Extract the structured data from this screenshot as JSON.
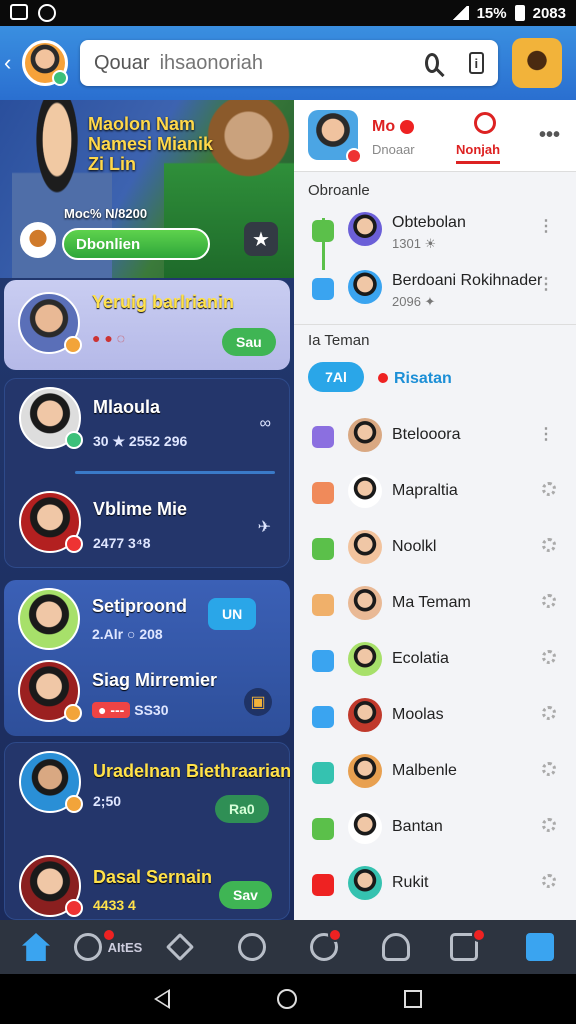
{
  "status_bar": {
    "battery": "15%",
    "time": "2083"
  },
  "search": {
    "prefix": "Qouar",
    "placeholder": "ihsaonoriah",
    "icon": "search-icon",
    "info": "i"
  },
  "hero": {
    "title_line1": "Maolon Nam",
    "title_line2": "Namesi Mianik",
    "title_line3": "Zi Lin",
    "meta": "Moc% N/8200",
    "button": "Dbonlien"
  },
  "left_list": [
    {
      "name": "Yeruig barlrianin",
      "sub": "",
      "action": "Sau",
      "theme": "light"
    },
    {
      "name": "Mlaoula",
      "sub": "30 ★ 2552 296",
      "action": "",
      "theme": "dark"
    },
    {
      "name": "Vblime Mie",
      "sub": "2477 3⁴8",
      "action": "",
      "theme": "dark"
    },
    {
      "name": "Setiproond",
      "sub": "2.Alr ○ 208",
      "action": "UN",
      "theme": "blue"
    },
    {
      "name": "Siag Mirremier",
      "sub": "SS30",
      "action": "",
      "theme": "blue"
    },
    {
      "name": "Uradelnan Biethraarian",
      "sub": "2;50",
      "action": "Ra0",
      "theme": "dark"
    },
    {
      "name": "Dasal Sernain",
      "sub": "4433 4",
      "action": "Sav",
      "theme": "dark"
    }
  ],
  "right_panel": {
    "tab1": "Mo",
    "tab1_sub": "Dnoaar",
    "tab2": "Nonjah",
    "section1": "Obroanle",
    "section2": "Ia Teman",
    "friend_pill": "7Al",
    "friend_label": "Risatan",
    "top_items": [
      {
        "name": "Obtebolan",
        "sub": "1301 ☀"
      },
      {
        "name": "Berdoani Rokihnader",
        "sub": "2096 ✦"
      }
    ],
    "items": [
      {
        "name": "Btelooora",
        "color": "#8b6fe0"
      },
      {
        "name": "Mapraltia",
        "color": "#f08a5a"
      },
      {
        "name": "Noolkl",
        "color": "#5bc04a"
      },
      {
        "name": "Ma Temam",
        "color": "#f0b06a"
      },
      {
        "name": "Ecolatia",
        "color": "#3aa4f0"
      },
      {
        "name": "Moolas",
        "color": "#3aa4f0"
      },
      {
        "name": "Malbenle",
        "color": "#35c2b0"
      },
      {
        "name": "Bantan",
        "color": "#5bc04a"
      },
      {
        "name": "Rukit",
        "color": "#e22"
      }
    ]
  },
  "bottom_nav": {
    "items": [
      "home",
      "games",
      "tools",
      "add",
      "search",
      "profile",
      "news",
      "apps"
    ],
    "games_label": "AItES"
  },
  "colors": {
    "accent": "#3a8fe0",
    "left_bg": "#233b73",
    "highlight": "#ffe14a"
  }
}
